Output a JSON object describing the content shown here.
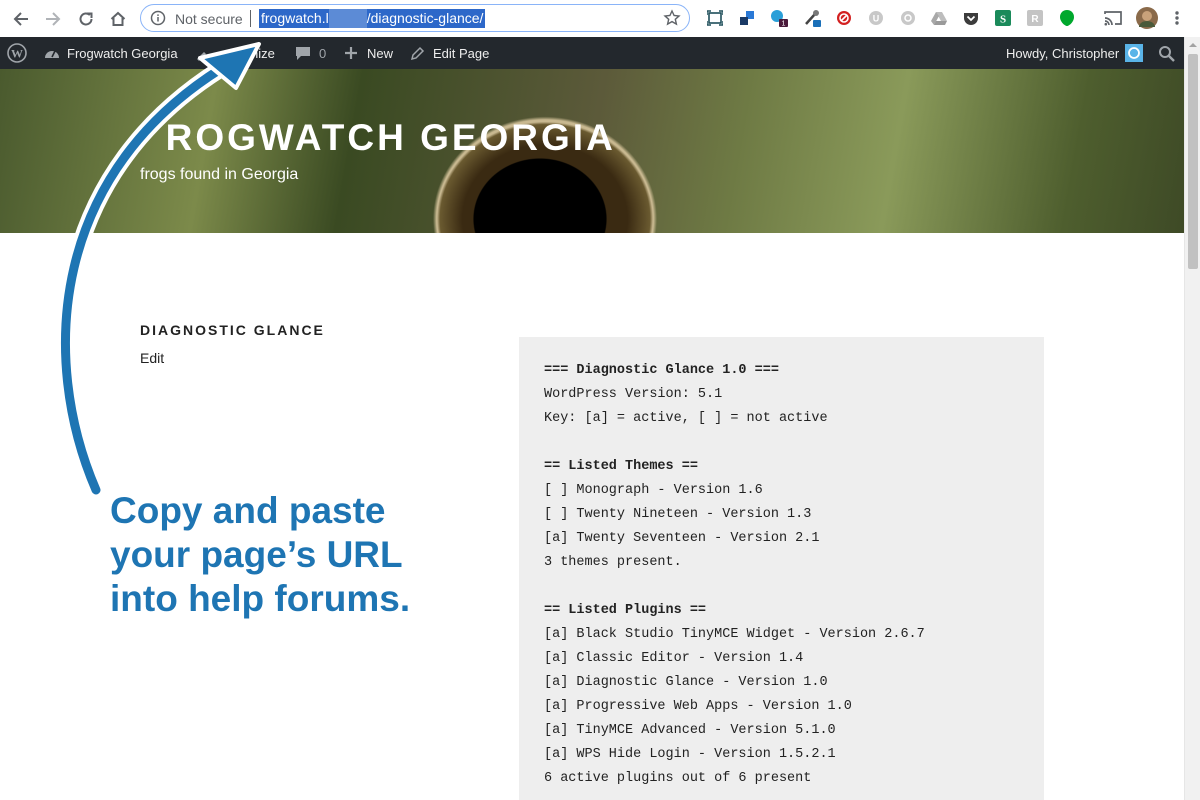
{
  "browser": {
    "security_label": "Not secure",
    "url_before_redaction": "frogwatch.l",
    "url_after_redaction": "/diagnostic-glance/",
    "extension_icons": [
      "screenshot-icon",
      "extension-blue-icon",
      "extension-badge-icon",
      "extension-tool-icon",
      "block-icon",
      "extension-gray-u-icon",
      "extension-gray-circle-icon",
      "drive-icon",
      "pocket-icon",
      "extension-green-s-icon",
      "extension-gray-r-icon",
      "evernote-icon",
      "cast-icon",
      "profile-avatar"
    ],
    "badge_count": "1"
  },
  "admin_bar": {
    "site_name": "Frogwatch Georgia",
    "customize_label": "nize",
    "comments_count": "0",
    "new_label": "New",
    "edit_page_label": "Edit Page",
    "greeting": "Howdy, Christopher"
  },
  "site": {
    "title": "FROGWATCH GEORGIA",
    "title_visible": "ROGWATCH GEORGIA",
    "tagline": "frogs found in Georgia"
  },
  "page": {
    "title": "DIAGNOSTIC GLANCE",
    "edit_label": "Edit"
  },
  "diagnostics": {
    "lines": [
      "=== Diagnostic Glance 1.0 ===",
      "WordPress Version: 5.1",
      "Key: [a] = active, [ ] = not active",
      "",
      "== Listed Themes ==",
      "[ ] Monograph - Version 1.6",
      "[ ] Twenty Nineteen - Version 1.3",
      "[a] Twenty Seventeen - Version 2.1",
      "3 themes present.",
      "",
      "== Listed Plugins ==",
      "[a] Black Studio TinyMCE Widget - Version 2.6.7",
      "[a] Classic Editor - Version 1.4",
      "[a] Diagnostic Glance - Version 1.0",
      "[a] Progressive Web Apps - Version 1.0",
      "[a] TinyMCE Advanced - Version 5.1.0",
      "[a] WPS Hide Login - Version 1.5.2.1",
      "6 active plugins out of 6 present"
    ]
  },
  "annotation": {
    "line1": "Copy and paste",
    "line2": "your page’s URL",
    "line3": "into help forums.",
    "color": "#1e75b3"
  }
}
